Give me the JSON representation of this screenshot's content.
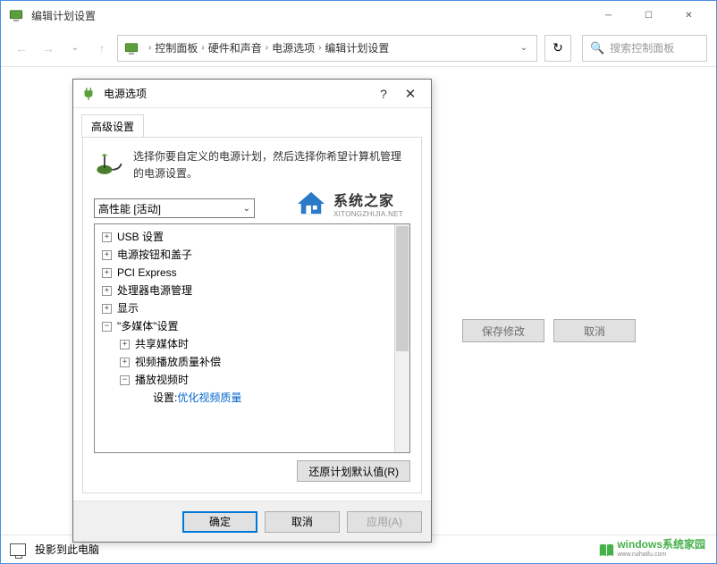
{
  "mainWindow": {
    "title": "编辑计划设置"
  },
  "breadcrumb": {
    "items": [
      "控制面板",
      "硬件和声音",
      "电源选项",
      "编辑计划设置"
    ]
  },
  "search": {
    "placeholder": "搜索控制面板"
  },
  "bgButtons": {
    "save": "保存修改",
    "cancel": "取消"
  },
  "dialog": {
    "title": "电源选项",
    "tab": "高级设置",
    "description": "选择你要自定义的电源计划，然后选择你希望计算机管理的电源设置。",
    "planSelected": "高性能 [活动]",
    "tree": {
      "usb": "USB 设置",
      "powerButton": "电源按钮和盖子",
      "pciExpress": "PCI Express",
      "processor": "处理器电源管理",
      "display": "显示",
      "multimedia": "\"多媒体\"设置",
      "shareMedia": "共享媒体时",
      "videoQualityComp": "视频播放质量补偿",
      "playVideo": "播放视频时",
      "settingLabel": "设置:",
      "settingValue": "优化视频质量"
    },
    "restoreBtn": "还原计划默认值(R)",
    "ok": "确定",
    "cancel": "取消",
    "apply": "应用(A)"
  },
  "bottomBar": {
    "label": "投影到此电脑"
  },
  "watermark1": {
    "zh": "系统之家",
    "en": "XITONGZHIJIA.NET"
  },
  "watermark2": {
    "main": "windows系统家园",
    "sub": "www.ruihaifu.com"
  }
}
